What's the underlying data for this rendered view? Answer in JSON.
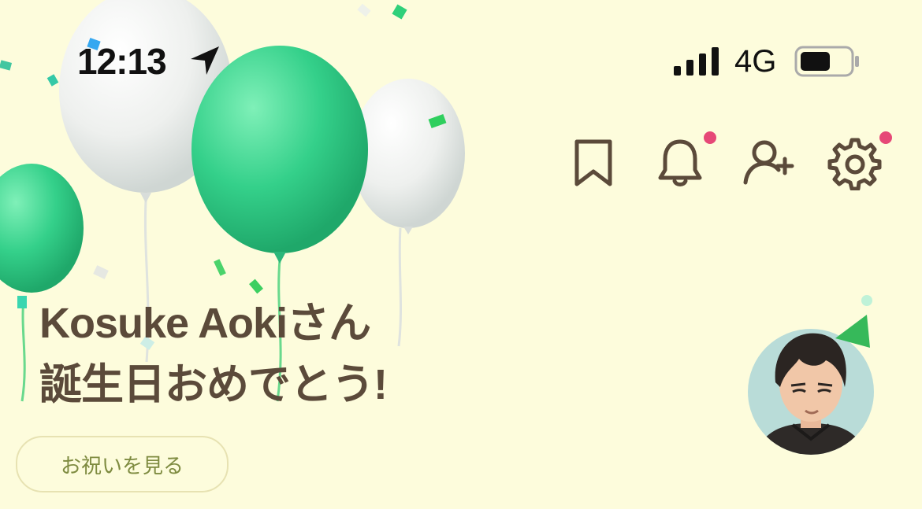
{
  "status_bar": {
    "time": "12:13",
    "network": "4G",
    "signal_bars": 4,
    "battery_level": 0.6
  },
  "toolbar": {
    "icons": [
      "bookmark-icon",
      "bell-icon",
      "add-friend-icon",
      "gear-icon"
    ],
    "badges": {
      "bell": true,
      "settings": true
    }
  },
  "greeting": {
    "name_line": "Kosuke Aokiさん",
    "message_line": "誕生日おめでとう!"
  },
  "celebrate_button": {
    "label": "お祝いを見る"
  },
  "colors": {
    "background": "#fdfcdc",
    "text": "#5b4a3a",
    "accent_green": "#35d08c",
    "badge": "#e64877",
    "button_text": "#7e8b40"
  }
}
